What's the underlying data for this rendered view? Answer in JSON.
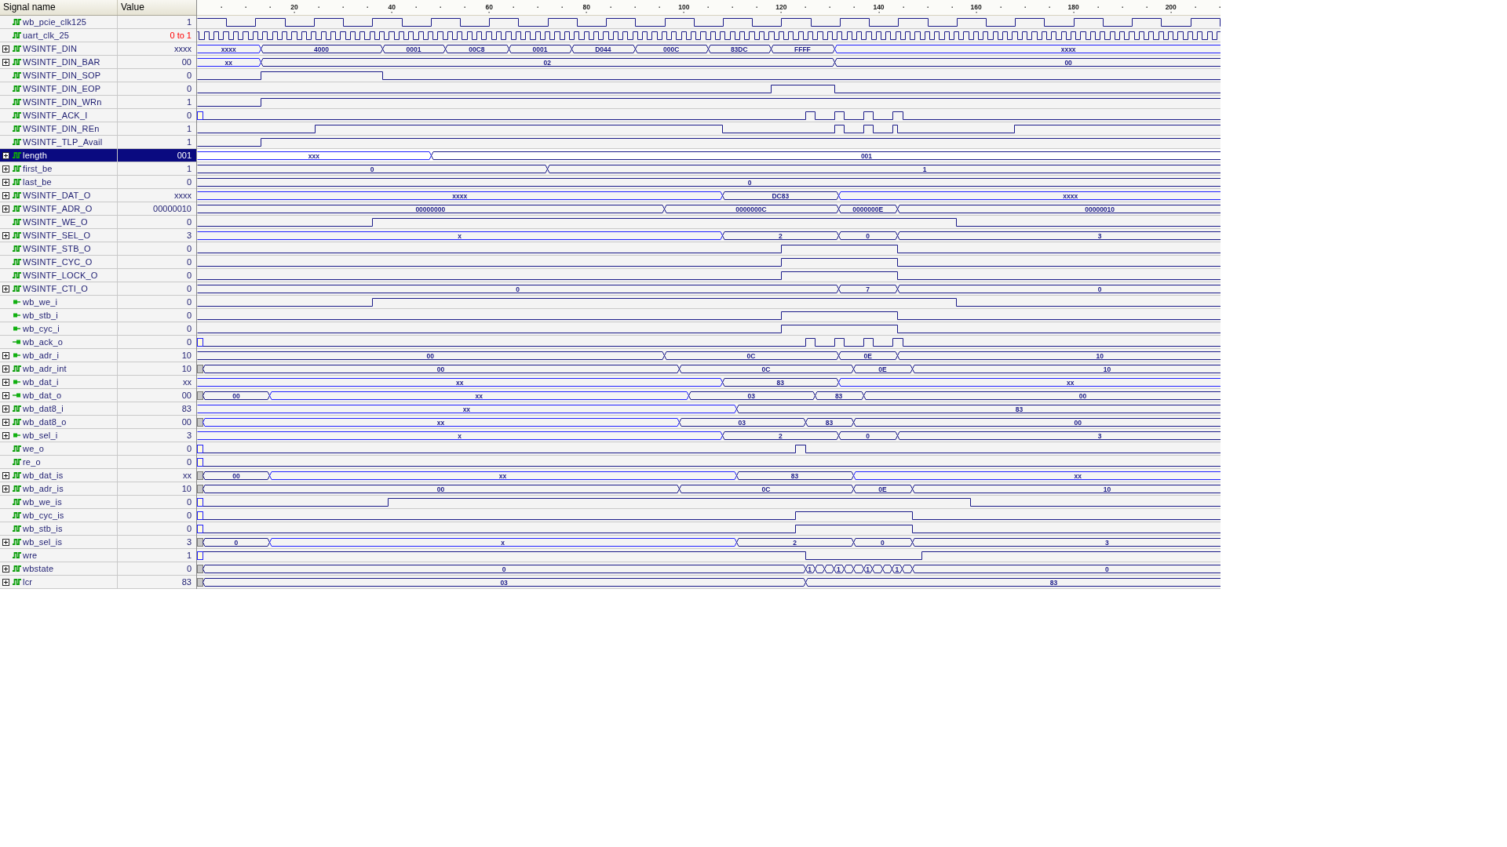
{
  "columns": [
    "Signal name",
    "Value"
  ],
  "ruler": {
    "ticks": [
      "20",
      "40",
      "60",
      "80",
      "100",
      "120",
      "140",
      "160",
      "180",
      "200"
    ]
  },
  "signals": [
    {
      "name": "wb_pcie_clk125",
      "value": "1",
      "kind": "signal",
      "expandable": false,
      "selected": false,
      "changing": false,
      "wave": {
        "kind": "clock"
      }
    },
    {
      "name": "uart_clk_25",
      "value": "0 to 1",
      "kind": "signal",
      "expandable": false,
      "selected": false,
      "changing": true,
      "wave": {
        "kind": "clock"
      }
    },
    {
      "name": "WSINTF_DIN",
      "value": "xxxx",
      "kind": "signal",
      "expandable": true,
      "expanded": false,
      "selected": false,
      "changing": false,
      "wave": {
        "kind": "bus",
        "segments": [
          {
            "kind": "undefined",
            "label": "xxxx"
          },
          {
            "kind": "valid",
            "label": "4000"
          },
          {
            "kind": "valid",
            "label": "0001"
          },
          {
            "kind": "valid",
            "label": "00C8"
          },
          {
            "kind": "valid",
            "label": "0001"
          },
          {
            "kind": "valid",
            "label": "D044"
          },
          {
            "kind": "valid",
            "label": "000C"
          },
          {
            "kind": "valid",
            "label": "83DC"
          },
          {
            "kind": "valid",
            "label": "FFFF"
          },
          {
            "kind": "undefined",
            "label": "xxxx"
          }
        ]
      }
    },
    {
      "name": "WSINTF_DIN_BAR",
      "value": "00",
      "kind": "signal",
      "expandable": true,
      "expanded": false,
      "selected": false,
      "changing": false,
      "wave": {
        "kind": "bus",
        "segments": [
          {
            "kind": "undefined",
            "label": "xx"
          },
          {
            "kind": "valid",
            "label": "02"
          },
          {
            "kind": "valid",
            "label": "00"
          }
        ]
      }
    },
    {
      "name": "WSINTF_DIN_SOP",
      "value": "0",
      "kind": "signal",
      "expandable": false,
      "selected": false,
      "changing": false,
      "wave": {
        "kind": "bit",
        "segments": [
          {
            "kind": "low"
          },
          {
            "kind": "high"
          },
          {
            "kind": "low"
          }
        ]
      }
    },
    {
      "name": "WSINTF_DIN_EOP",
      "value": "0",
      "kind": "signal",
      "expandable": false,
      "selected": false,
      "changing": false,
      "wave": {
        "kind": "bit",
        "segments": [
          {
            "kind": "low"
          },
          {
            "kind": "high"
          },
          {
            "kind": "low"
          }
        ]
      }
    },
    {
      "name": "WSINTF_DIN_WRn",
      "value": "1",
      "kind": "signal",
      "expandable": false,
      "selected": false,
      "changing": false,
      "wave": {
        "kind": "bit",
        "segments": [
          {
            "kind": "low"
          },
          {
            "kind": "high"
          }
        ]
      }
    },
    {
      "name": "WSINTF_ACK_I",
      "value": "0",
      "kind": "signal",
      "expandable": false,
      "selected": false,
      "changing": false,
      "wave": {
        "kind": "bit",
        "segments": [
          {
            "kind": "init"
          },
          {
            "kind": "low"
          },
          {
            "kind": "high"
          },
          {
            "kind": "low"
          },
          {
            "kind": "high"
          },
          {
            "kind": "low"
          },
          {
            "kind": "high"
          },
          {
            "kind": "low"
          },
          {
            "kind": "high"
          },
          {
            "kind": "low"
          }
        ]
      }
    },
    {
      "name": "WSINTF_DIN_REn",
      "value": "1",
      "kind": "signal",
      "expandable": false,
      "selected": false,
      "changing": false,
      "wave": {
        "kind": "bit",
        "segments": [
          {
            "kind": "low"
          },
          {
            "kind": "high"
          },
          {
            "kind": "low"
          },
          {
            "kind": "high"
          },
          {
            "kind": "low"
          },
          {
            "kind": "high"
          },
          {
            "kind": "low"
          },
          {
            "kind": "high"
          },
          {
            "kind": "low"
          },
          {
            "kind": "high"
          }
        ]
      }
    },
    {
      "name": "WSINTF_TLP_Avail",
      "value": "1",
      "kind": "signal",
      "expandable": false,
      "selected": false,
      "changing": false,
      "wave": {
        "kind": "bit",
        "segments": [
          {
            "kind": "low"
          },
          {
            "kind": "high"
          }
        ]
      }
    },
    {
      "name": "length",
      "value": "001",
      "kind": "signal",
      "expandable": true,
      "expanded": false,
      "selected": true,
      "changing": false,
      "wave": {
        "kind": "bus",
        "segments": [
          {
            "kind": "undefined",
            "label": "xxx"
          },
          {
            "kind": "valid",
            "label": "001"
          }
        ]
      }
    },
    {
      "name": "first_be",
      "value": "1",
      "kind": "signal",
      "expandable": true,
      "expanded": false,
      "selected": false,
      "changing": false,
      "wave": {
        "kind": "bus",
        "segments": [
          {
            "kind": "valid",
            "label": "0"
          },
          {
            "kind": "valid",
            "label": "1"
          }
        ]
      }
    },
    {
      "name": "last_be",
      "value": "0",
      "kind": "signal",
      "expandable": true,
      "expanded": false,
      "selected": false,
      "changing": false,
      "wave": {
        "kind": "bus",
        "segments": [
          {
            "kind": "valid",
            "label": "0"
          }
        ]
      }
    },
    {
      "name": "WSINTF_DAT_O",
      "value": "xxxx",
      "kind": "signal",
      "expandable": true,
      "expanded": false,
      "selected": false,
      "changing": false,
      "wave": {
        "kind": "bus",
        "segments": [
          {
            "kind": "undefined",
            "label": "xxxx"
          },
          {
            "kind": "valid",
            "label": "DC83"
          },
          {
            "kind": "undefined",
            "label": "xxxx"
          }
        ]
      }
    },
    {
      "name": "WSINTF_ADR_O",
      "value": "00000010",
      "kind": "signal",
      "expandable": true,
      "expanded": false,
      "selected": false,
      "changing": false,
      "wave": {
        "kind": "bus",
        "segments": [
          {
            "kind": "valid",
            "label": "00000000"
          },
          {
            "kind": "valid",
            "label": "0000000C"
          },
          {
            "kind": "valid",
            "label": "0000000E"
          },
          {
            "kind": "valid",
            "label": "00000010"
          }
        ]
      }
    },
    {
      "name": "WSINTF_WE_O",
      "value": "0",
      "kind": "signal",
      "expandable": false,
      "selected": false,
      "changing": false,
      "wave": {
        "kind": "bit",
        "segments": [
          {
            "kind": "low"
          },
          {
            "kind": "high"
          },
          {
            "kind": "low"
          }
        ]
      }
    },
    {
      "name": "WSINTF_SEL_O",
      "value": "3",
      "kind": "signal",
      "expandable": true,
      "expanded": false,
      "selected": false,
      "changing": false,
      "wave": {
        "kind": "bus",
        "segments": [
          {
            "kind": "undefined",
            "label": "x"
          },
          {
            "kind": "valid",
            "label": "2"
          },
          {
            "kind": "valid",
            "label": "0"
          },
          {
            "kind": "valid",
            "label": "3"
          }
        ]
      }
    },
    {
      "name": "WSINTF_STB_O",
      "value": "0",
      "kind": "signal",
      "expandable": false,
      "selected": false,
      "changing": false,
      "wave": {
        "kind": "bit",
        "segments": [
          {
            "kind": "low"
          },
          {
            "kind": "high"
          },
          {
            "kind": "low"
          }
        ]
      }
    },
    {
      "name": "WSINTF_CYC_O",
      "value": "0",
      "kind": "signal",
      "expandable": false,
      "selected": false,
      "changing": false,
      "wave": {
        "kind": "bit",
        "segments": [
          {
            "kind": "low"
          },
          {
            "kind": "high"
          },
          {
            "kind": "low"
          }
        ]
      }
    },
    {
      "name": "WSINTF_LOCK_O",
      "value": "0",
      "kind": "signal",
      "expandable": false,
      "selected": false,
      "changing": false,
      "wave": {
        "kind": "bit",
        "segments": [
          {
            "kind": "low"
          },
          {
            "kind": "high"
          },
          {
            "kind": "low"
          }
        ]
      }
    },
    {
      "name": "WSINTF_CTI_O",
      "value": "0",
      "kind": "signal",
      "expandable": true,
      "expanded": false,
      "selected": false,
      "changing": false,
      "wave": {
        "kind": "bus",
        "segments": [
          {
            "kind": "valid",
            "label": "0"
          },
          {
            "kind": "valid",
            "label": "7"
          },
          {
            "kind": "valid",
            "label": "0"
          }
        ]
      }
    },
    {
      "name": "wb_we_i",
      "value": "0",
      "kind": "input",
      "expandable": false,
      "selected": false,
      "changing": false,
      "wave": {
        "kind": "bit",
        "segments": [
          {
            "kind": "low"
          },
          {
            "kind": "high"
          },
          {
            "kind": "low"
          }
        ]
      }
    },
    {
      "name": "wb_stb_i",
      "value": "0",
      "kind": "input",
      "expandable": false,
      "selected": false,
      "changing": false,
      "wave": {
        "kind": "bit",
        "segments": [
          {
            "kind": "low"
          },
          {
            "kind": "high"
          },
          {
            "kind": "low"
          }
        ]
      }
    },
    {
      "name": "wb_cyc_i",
      "value": "0",
      "kind": "input",
      "expandable": false,
      "selected": false,
      "changing": false,
      "wave": {
        "kind": "bit",
        "segments": [
          {
            "kind": "low"
          },
          {
            "kind": "high"
          },
          {
            "kind": "low"
          }
        ]
      }
    },
    {
      "name": "wb_ack_o",
      "value": "0",
      "kind": "output",
      "expandable": false,
      "selected": false,
      "changing": false,
      "wave": {
        "kind": "bit",
        "segments": [
          {
            "kind": "init"
          },
          {
            "kind": "low"
          },
          {
            "kind": "high"
          },
          {
            "kind": "low"
          },
          {
            "kind": "high"
          },
          {
            "kind": "low"
          },
          {
            "kind": "high"
          },
          {
            "kind": "low"
          },
          {
            "kind": "high"
          },
          {
            "kind": "low"
          }
        ]
      }
    },
    {
      "name": "wb_adr_i",
      "value": "10",
      "kind": "input",
      "expandable": true,
      "expanded": false,
      "selected": false,
      "changing": false,
      "wave": {
        "kind": "bus",
        "segments": [
          {
            "kind": "valid",
            "label": "00"
          },
          {
            "kind": "valid",
            "label": "0C"
          },
          {
            "kind": "valid",
            "label": "0E"
          },
          {
            "kind": "valid",
            "label": "10"
          }
        ]
      }
    },
    {
      "name": "wb_adr_int",
      "value": "10",
      "kind": "signal",
      "expandable": true,
      "expanded": false,
      "selected": false,
      "changing": false,
      "wave": {
        "kind": "bus",
        "segments": [
          {
            "kind": "uninit"
          },
          {
            "kind": "valid",
            "label": "00"
          },
          {
            "kind": "valid",
            "label": "0C"
          },
          {
            "kind": "valid",
            "label": "0E"
          },
          {
            "kind": "valid",
            "label": "10"
          }
        ]
      }
    },
    {
      "name": "wb_dat_i",
      "value": "xx",
      "kind": "input",
      "expandable": true,
      "expanded": false,
      "selected": false,
      "changing": false,
      "wave": {
        "kind": "bus",
        "segments": [
          {
            "kind": "undefined",
            "label": "xx"
          },
          {
            "kind": "valid",
            "label": "83"
          },
          {
            "kind": "undefined",
            "label": "xx"
          }
        ]
      }
    },
    {
      "name": "wb_dat_o",
      "value": "00",
      "kind": "output",
      "expandable": true,
      "expanded": false,
      "selected": false,
      "changing": false,
      "wave": {
        "kind": "bus",
        "segments": [
          {
            "kind": "uninit"
          },
          {
            "kind": "valid",
            "label": "00"
          },
          {
            "kind": "undefined",
            "label": "xx"
          },
          {
            "kind": "valid",
            "label": "03"
          },
          {
            "kind": "valid",
            "label": "83"
          },
          {
            "kind": "valid",
            "label": "00"
          }
        ]
      }
    },
    {
      "name": "wb_dat8_i",
      "value": "83",
      "kind": "signal",
      "expandable": true,
      "expanded": false,
      "selected": false,
      "changing": false,
      "wave": {
        "kind": "bus",
        "segments": [
          {
            "kind": "undefined",
            "label": "xx"
          },
          {
            "kind": "valid",
            "label": "83"
          }
        ]
      }
    },
    {
      "name": "wb_dat8_o",
      "value": "00",
      "kind": "signal",
      "expandable": true,
      "expanded": false,
      "selected": false,
      "changing": false,
      "wave": {
        "kind": "bus",
        "segments": [
          {
            "kind": "uninit"
          },
          {
            "kind": "undefined",
            "label": "xx"
          },
          {
            "kind": "valid",
            "label": "03"
          },
          {
            "kind": "valid",
            "label": "83"
          },
          {
            "kind": "valid",
            "label": "00"
          }
        ]
      }
    },
    {
      "name": "wb_sel_i",
      "value": "3",
      "kind": "input",
      "expandable": true,
      "expanded": false,
      "selected": false,
      "changing": false,
      "wave": {
        "kind": "bus",
        "segments": [
          {
            "kind": "undefined",
            "label": "x"
          },
          {
            "kind": "valid",
            "label": "2"
          },
          {
            "kind": "valid",
            "label": "0"
          },
          {
            "kind": "valid",
            "label": "3"
          }
        ]
      }
    },
    {
      "name": "we_o",
      "value": "0",
      "kind": "signal",
      "expandable": false,
      "selected": false,
      "changing": false,
      "wave": {
        "kind": "bit",
        "segments": [
          {
            "kind": "init"
          },
          {
            "kind": "low"
          },
          {
            "kind": "high"
          },
          {
            "kind": "low"
          }
        ]
      }
    },
    {
      "name": "re_o",
      "value": "0",
      "kind": "signal",
      "expandable": false,
      "selected": false,
      "changing": false,
      "wave": {
        "kind": "bit",
        "segments": [
          {
            "kind": "init"
          },
          {
            "kind": "low"
          }
        ]
      }
    },
    {
      "name": "wb_dat_is",
      "value": "xx",
      "kind": "signal",
      "expandable": true,
      "expanded": false,
      "selected": false,
      "changing": false,
      "wave": {
        "kind": "bus",
        "segments": [
          {
            "kind": "uninit"
          },
          {
            "kind": "valid",
            "label": "00"
          },
          {
            "kind": "undefined",
            "label": "xx"
          },
          {
            "kind": "valid",
            "label": "83"
          },
          {
            "kind": "undefined",
            "label": "xx"
          }
        ]
      }
    },
    {
      "name": "wb_adr_is",
      "value": "10",
      "kind": "signal",
      "expandable": true,
      "expanded": false,
      "selected": false,
      "changing": false,
      "wave": {
        "kind": "bus",
        "segments": [
          {
            "kind": "uninit"
          },
          {
            "kind": "valid",
            "label": "00"
          },
          {
            "kind": "valid",
            "label": "0C"
          },
          {
            "kind": "valid",
            "label": "0E"
          },
          {
            "kind": "valid",
            "label": "10"
          }
        ]
      }
    },
    {
      "name": "wb_we_is",
      "value": "0",
      "kind": "signal",
      "expandable": false,
      "selected": false,
      "changing": false,
      "wave": {
        "kind": "bit",
        "segments": [
          {
            "kind": "init"
          },
          {
            "kind": "low"
          },
          {
            "kind": "high"
          },
          {
            "kind": "low"
          }
        ]
      }
    },
    {
      "name": "wb_cyc_is",
      "value": "0",
      "kind": "signal",
      "expandable": false,
      "selected": false,
      "changing": false,
      "wave": {
        "kind": "bit",
        "segments": [
          {
            "kind": "init"
          },
          {
            "kind": "low"
          },
          {
            "kind": "high"
          },
          {
            "kind": "low"
          }
        ]
      }
    },
    {
      "name": "wb_stb_is",
      "value": "0",
      "kind": "signal",
      "expandable": false,
      "selected": false,
      "changing": false,
      "wave": {
        "kind": "bit",
        "segments": [
          {
            "kind": "init"
          },
          {
            "kind": "low"
          },
          {
            "kind": "high"
          },
          {
            "kind": "low"
          }
        ]
      }
    },
    {
      "name": "wb_sel_is",
      "value": "3",
      "kind": "signal",
      "expandable": true,
      "expanded": false,
      "selected": false,
      "changing": false,
      "wave": {
        "kind": "bus",
        "segments": [
          {
            "kind": "uninit"
          },
          {
            "kind": "valid",
            "label": "0"
          },
          {
            "kind": "undefined",
            "label": "x"
          },
          {
            "kind": "valid",
            "label": "2"
          },
          {
            "kind": "valid",
            "label": "0"
          },
          {
            "kind": "valid",
            "label": "3"
          }
        ]
      }
    },
    {
      "name": "wre",
      "value": "1",
      "kind": "signal",
      "expandable": false,
      "selected": false,
      "changing": false,
      "wave": {
        "kind": "bit",
        "segments": [
          {
            "kind": "init"
          },
          {
            "kind": "high"
          },
          {
            "kind": "low"
          },
          {
            "kind": "high"
          }
        ]
      }
    },
    {
      "name": "wbstate",
      "value": "0",
      "kind": "signal",
      "expandable": true,
      "expanded": false,
      "selected": false,
      "changing": false,
      "wave": {
        "kind": "bus",
        "segments": [
          {
            "kind": "uninit"
          },
          {
            "kind": "valid",
            "label": "0"
          },
          {
            "kind": "valid",
            "label": "1"
          },
          {
            "kind": "valid"
          },
          {
            "kind": "valid"
          },
          {
            "kind": "valid",
            "label": "1"
          },
          {
            "kind": "valid"
          },
          {
            "kind": "valid"
          },
          {
            "kind": "valid",
            "label": "1"
          },
          {
            "kind": "valid"
          },
          {
            "kind": "valid"
          },
          {
            "kind": "valid",
            "label": "1"
          },
          {
            "kind": "valid"
          },
          {
            "kind": "valid",
            "label": "0"
          }
        ]
      }
    },
    {
      "name": "lcr",
      "value": "83",
      "kind": "signal",
      "expandable": true,
      "expanded": false,
      "selected": false,
      "changing": false,
      "wave": {
        "kind": "bus",
        "segments": [
          {
            "kind": "uninit"
          },
          {
            "kind": "valid",
            "label": "03"
          },
          {
            "kind": "valid",
            "label": "83"
          }
        ]
      }
    }
  ]
}
